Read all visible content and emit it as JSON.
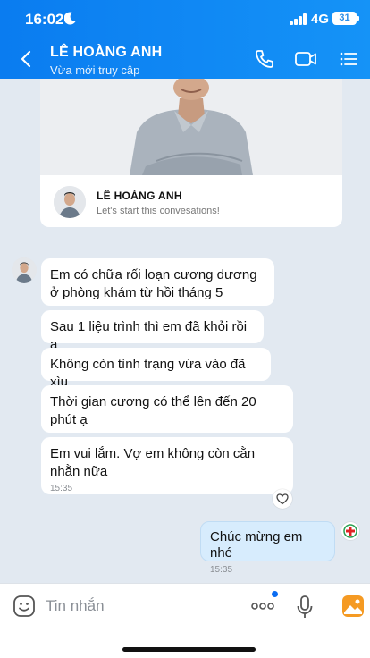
{
  "status_bar": {
    "time": "16:02",
    "network": "4G",
    "battery": "31"
  },
  "header": {
    "title": "LÊ HOÀNG ANH",
    "subtitle": "Vừa mới truy cập",
    "icons": [
      "back-arrow-icon",
      "phone-icon",
      "video-call-icon",
      "menu-list-icon"
    ]
  },
  "profile_card": {
    "name": "LÊ HOÀNG ANH",
    "subtitle": "Let's start this convesations!"
  },
  "messages": [
    {
      "text": "Em có chữa rối loạn cương dương ở phòng khám từ hồi tháng 5"
    },
    {
      "text": "Sau 1 liệu trình thì em đã khỏi rồi ạ"
    },
    {
      "text": "Không còn tình trạng vừa vào đã xìu"
    },
    {
      "text": "Thời gian cương có thể lên đến 20 phút ạ"
    },
    {
      "text": "Em vui lắm. Vợ em không còn cằn nhằn nữa",
      "time": "15:35"
    }
  ],
  "my_message": {
    "text": "Chúc mừng em nhé",
    "time": "15:35"
  },
  "input": {
    "placeholder": "Tin nhắn"
  },
  "colors": {
    "header": "#0a7cf0",
    "my_bubble": "#d7ecfd",
    "background": "#e2e9f1"
  }
}
